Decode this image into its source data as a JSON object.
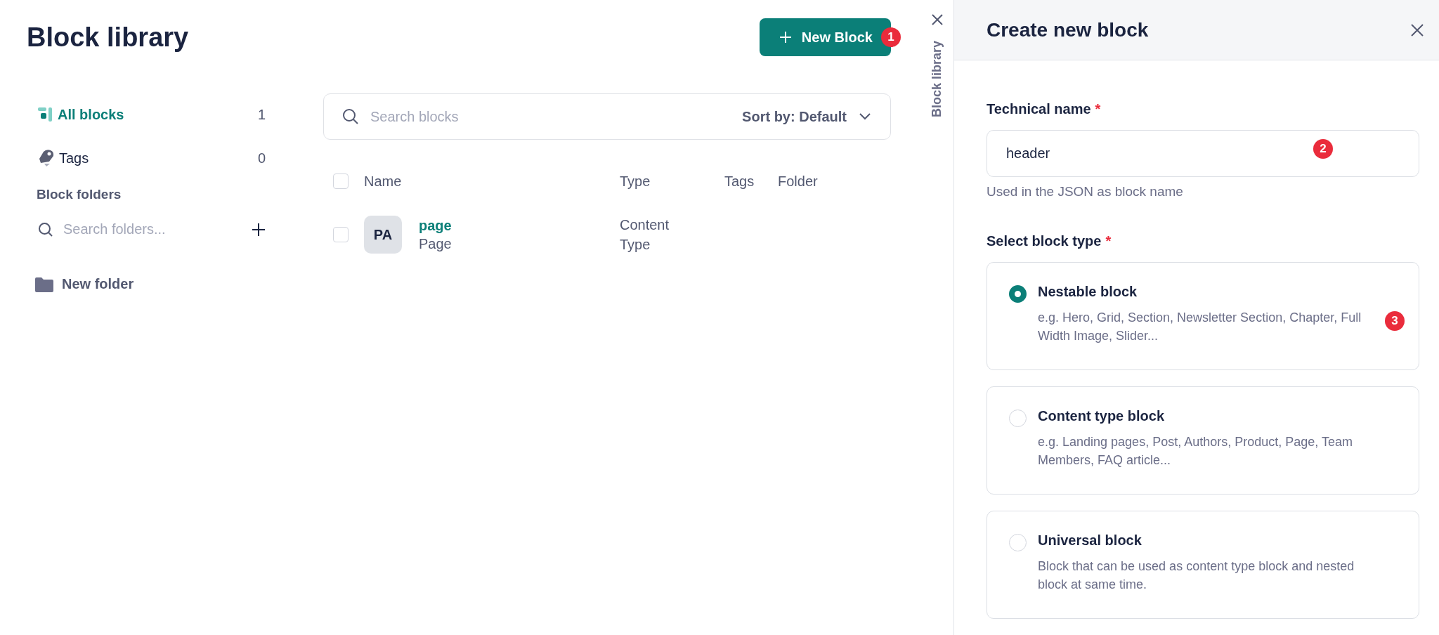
{
  "library": {
    "title": "Block library",
    "new_button": "New Block",
    "new_badge": "1",
    "sidebar": {
      "items": [
        {
          "kind": "blocks",
          "label": "All blocks",
          "count": "1",
          "selected": true
        },
        {
          "kind": "tags",
          "label": "Tags",
          "count": "0",
          "selected": false
        }
      ],
      "folders_heading": "Block folders",
      "folder_search": {
        "placeholder": "Search folders..."
      },
      "folders": [
        {
          "label": "New folder"
        }
      ]
    },
    "search": {
      "placeholder": "Search blocks"
    },
    "sort": "Sort by: Default",
    "table": {
      "select_all_checked": false,
      "columns": [
        "Name",
        "Type",
        "Tags",
        "Folder"
      ],
      "rows": [
        {
          "checked": false,
          "avatar": "PA",
          "name": "page",
          "subtitle": "Page",
          "type": "Content Type"
        }
      ]
    }
  },
  "side_tab": {
    "label": "Block library"
  },
  "dialog": {
    "title": "Create new block",
    "name_field": {
      "label": "Technical name",
      "required_mark": "*",
      "value": "header",
      "badge": "2",
      "help": "Used in the JSON as block name"
    },
    "type_label": "Select block type",
    "type_required_mark": "*",
    "types": [
      {
        "title": "Nestable block",
        "description": "e.g. Hero, Grid, Section, Newsletter Section, Chapter, Full Width Image, Slider...",
        "selected": true,
        "badge": "3"
      },
      {
        "title": "Content type block",
        "description": "e.g. Landing pages, Post, Authors, Product, Page, Team Members, FAQ article...",
        "selected": false
      },
      {
        "title": "Universal block",
        "description": "Block that can be used as content type block and nested block at same time.",
        "selected": false
      }
    ]
  }
}
